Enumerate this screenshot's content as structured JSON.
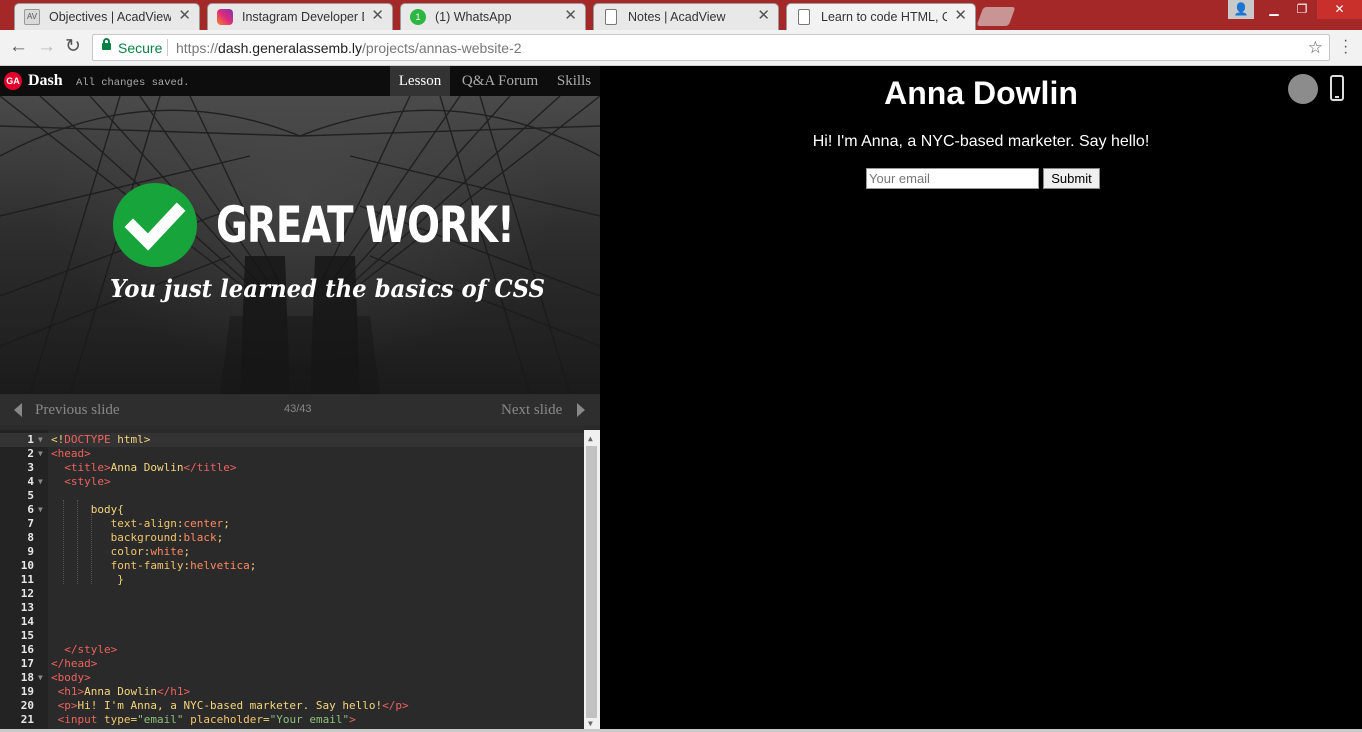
{
  "browser": {
    "tabs": [
      {
        "title": "Objectives | AcadView",
        "favicon": "acadview-icon",
        "active": false
      },
      {
        "title": "Instagram Developer Do",
        "favicon": "instagram-icon",
        "active": false
      },
      {
        "title": "(1) WhatsApp",
        "favicon": "whatsapp-icon",
        "active": false
      },
      {
        "title": "Notes | AcadView",
        "favicon": "document-icon",
        "active": false
      },
      {
        "title": "Learn to code HTML, CSS",
        "favicon": "document-icon",
        "active": true
      }
    ],
    "secure_label": "Secure",
    "url_prefix": "https://",
    "url_host": "dash.generalassemb.ly",
    "url_path": "/projects/annas-website-2"
  },
  "dash": {
    "logo": "GA",
    "name": "Dash",
    "status": "All changes saved.",
    "tabs": [
      "Lesson",
      "Q&A Forum",
      "Skills"
    ],
    "active_tab": "Lesson"
  },
  "slide": {
    "headline": "GREAT WORK!",
    "subline": "You just learned the basics of CSS",
    "prev_label": "Previous slide",
    "next_label": "Next slide",
    "counter": "43/43",
    "progress": 1.0,
    "colors": {
      "progress": "#e4002b",
      "check": "#17a43a"
    }
  },
  "editor": {
    "lines": [
      {
        "n": "1",
        "fold": true,
        "parts": [
          [
            "p",
            "<!"
          ],
          [
            "t",
            "DOCTYPE"
          ],
          [
            "p",
            " html>"
          ]
        ]
      },
      {
        "n": "2",
        "fold": true,
        "parts": [
          [
            "t",
            "<head>"
          ]
        ]
      },
      {
        "n": "3",
        "fold": false,
        "parts": [
          [
            "p",
            "  "
          ],
          [
            "t",
            "<title>"
          ],
          [
            "p",
            "Anna Dowlin"
          ],
          [
            "t",
            "</title>"
          ]
        ]
      },
      {
        "n": "4",
        "fold": true,
        "parts": [
          [
            "p",
            "  "
          ],
          [
            "t",
            "<style>"
          ]
        ]
      },
      {
        "n": "5",
        "fold": false,
        "parts": []
      },
      {
        "n": "6",
        "fold": true,
        "parts": [
          [
            "p",
            "      body{"
          ]
        ]
      },
      {
        "n": "7",
        "fold": false,
        "parts": [
          [
            "p",
            "         "
          ],
          [
            "a",
            "text-align"
          ],
          [
            "p",
            ":"
          ],
          [
            "v",
            "center"
          ],
          [
            "p",
            ";"
          ]
        ]
      },
      {
        "n": "8",
        "fold": false,
        "parts": [
          [
            "p",
            "         "
          ],
          [
            "a",
            "background"
          ],
          [
            "p",
            ":"
          ],
          [
            "v",
            "black"
          ],
          [
            "p",
            ";"
          ]
        ]
      },
      {
        "n": "9",
        "fold": false,
        "parts": [
          [
            "p",
            "         "
          ],
          [
            "a",
            "color"
          ],
          [
            "p",
            ":"
          ],
          [
            "v",
            "white"
          ],
          [
            "p",
            ";"
          ]
        ]
      },
      {
        "n": "10",
        "fold": false,
        "parts": [
          [
            "p",
            "         "
          ],
          [
            "a",
            "font-family"
          ],
          [
            "p",
            ":"
          ],
          [
            "v",
            "helvetica"
          ],
          [
            "p",
            ";"
          ]
        ]
      },
      {
        "n": "11",
        "fold": false,
        "parts": [
          [
            "p",
            "          }"
          ]
        ]
      },
      {
        "n": "12",
        "fold": false,
        "parts": []
      },
      {
        "n": "13",
        "fold": false,
        "parts": []
      },
      {
        "n": "14",
        "fold": false,
        "parts": []
      },
      {
        "n": "15",
        "fold": false,
        "parts": []
      },
      {
        "n": "16",
        "fold": false,
        "parts": [
          [
            "p",
            "  "
          ],
          [
            "t",
            "</style>"
          ]
        ]
      },
      {
        "n": "17",
        "fold": false,
        "parts": [
          [
            "t",
            "</head>"
          ]
        ]
      },
      {
        "n": "18",
        "fold": true,
        "parts": [
          [
            "t",
            "<body>"
          ]
        ]
      },
      {
        "n": "19",
        "fold": false,
        "parts": [
          [
            "p",
            " "
          ],
          [
            "t",
            "<h1>"
          ],
          [
            "p",
            "Anna Dowlin"
          ],
          [
            "t",
            "</h1>"
          ]
        ]
      },
      {
        "n": "20",
        "fold": false,
        "parts": [
          [
            "p",
            " "
          ],
          [
            "t",
            "<p>"
          ],
          [
            "p",
            "Hi! I'm Anna, a NYC-based marketer. Say hello!"
          ],
          [
            "t",
            "</p>"
          ]
        ]
      },
      {
        "n": "21",
        "fold": false,
        "parts": [
          [
            "p",
            " "
          ],
          [
            "t",
            "<input"
          ],
          [
            "p",
            " "
          ],
          [
            "a",
            "type"
          ],
          [
            "p",
            "="
          ],
          [
            "s",
            "\"email\""
          ],
          [
            "p",
            " "
          ],
          [
            "a",
            "placeholder"
          ],
          [
            "p",
            "="
          ],
          [
            "s",
            "\"Your email\""
          ],
          [
            "t",
            ">"
          ]
        ]
      }
    ]
  },
  "preview": {
    "heading": "Anna Dowlin",
    "paragraph": "Hi! I'm Anna, a NYC-based marketer. Say hello!",
    "email_placeholder": "Your email",
    "submit_label": "Submit",
    "icons": [
      "desktop-view-icon",
      "mobile-view-icon"
    ]
  }
}
